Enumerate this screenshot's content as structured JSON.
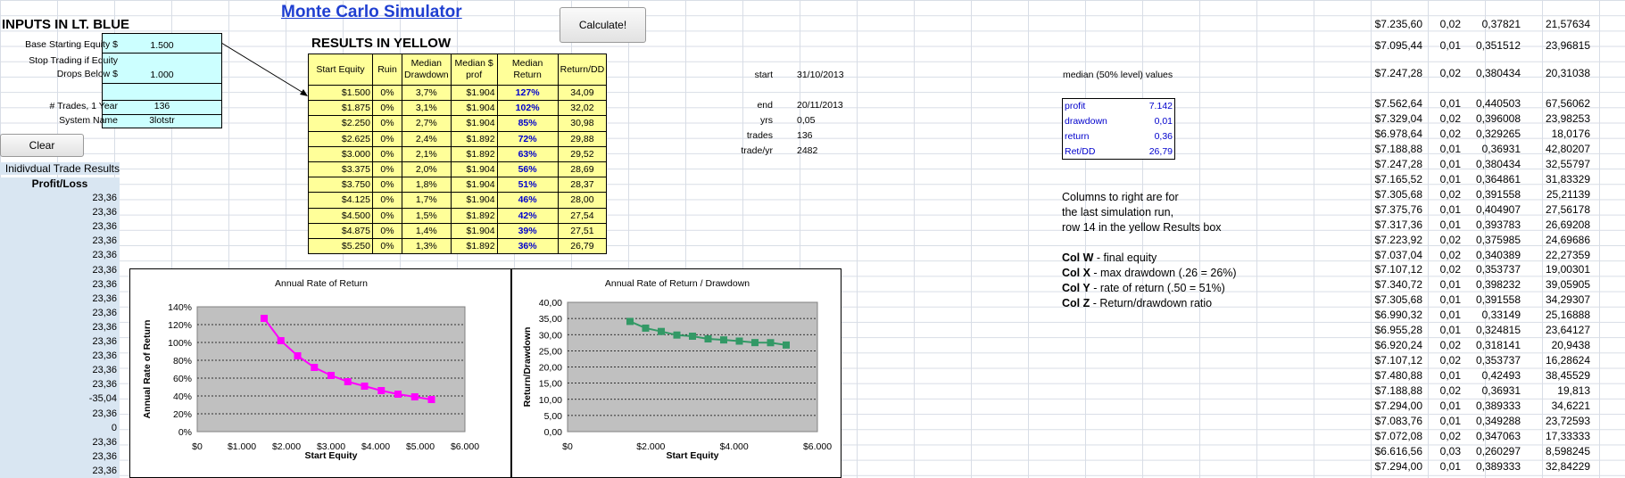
{
  "title": "Monte Carlo Simulator",
  "inputs_header": "INPUTS IN LT. BLUE",
  "results_header": "RESULTS IN YELLOW",
  "calculate_label": "Calculate!",
  "clear_label": "Clear",
  "inputs": [
    {
      "label": "Base Starting Equity $",
      "value": "1.500"
    },
    {
      "label1": "Stop Trading if Equity",
      "label2": "Drops Below $",
      "value": "1.000"
    },
    {
      "label": "# Trades, 1 Year",
      "value": "136"
    },
    {
      "label": "System Name",
      "value": "3lotstr"
    }
  ],
  "trade_results_label": "Inidivdual Trade Results",
  "profit_loss_label": "Profit/Loss",
  "profit_loss_values": [
    "23,36",
    "23,36",
    "23,36",
    "23,36",
    "23,36",
    "23,36",
    "23,36",
    "23,36",
    "23,36",
    "23,36",
    "23,36",
    "23,36",
    "23,36",
    "23,36",
    "-35,04",
    "23,36",
    "0",
    "23,36",
    "23,36",
    "23,36"
  ],
  "results_table": {
    "headers": [
      "Start Equity",
      "Ruin",
      "Median Drawdown",
      "Median $ prof",
      "Median Return",
      "Return/DD"
    ],
    "rows": [
      [
        "$1.500",
        "0%",
        "3,7%",
        "$1.904",
        "127%",
        "34,09"
      ],
      [
        "$1.875",
        "0%",
        "3,1%",
        "$1.904",
        "102%",
        "32,02"
      ],
      [
        "$2.250",
        "0%",
        "2,7%",
        "$1.904",
        "85%",
        "30,98"
      ],
      [
        "$2.625",
        "0%",
        "2,4%",
        "$1.892",
        "72%",
        "29,88"
      ],
      [
        "$3.000",
        "0%",
        "2,1%",
        "$1.892",
        "63%",
        "29,52"
      ],
      [
        "$3.375",
        "0%",
        "2,0%",
        "$1.904",
        "56%",
        "28,69"
      ],
      [
        "$3.750",
        "0%",
        "1,8%",
        "$1.904",
        "51%",
        "28,37"
      ],
      [
        "$4.125",
        "0%",
        "1,7%",
        "$1.904",
        "46%",
        "28,00"
      ],
      [
        "$4.500",
        "0%",
        "1,5%",
        "$1.892",
        "42%",
        "27,54"
      ],
      [
        "$4.875",
        "0%",
        "1,4%",
        "$1.904",
        "39%",
        "27,51"
      ],
      [
        "$5.250",
        "0%",
        "1,3%",
        "$1.892",
        "36%",
        "26,79"
      ]
    ]
  },
  "stats": [
    {
      "label": "start",
      "value": "31/10/2013"
    },
    {
      "label": "end",
      "value": "20/11/2013"
    },
    {
      "label": "yrs",
      "value": "0,05"
    },
    {
      "label": "trades",
      "value": "136"
    },
    {
      "label": "trade/yr",
      "value": "2482"
    }
  ],
  "median_header": "median (50% level) values",
  "median": [
    {
      "label": "profit",
      "value": "7.142"
    },
    {
      "label": "drawdown",
      "value": "0,01"
    },
    {
      "label": "return",
      "value": "0,36"
    },
    {
      "label": "Ret/DD",
      "value": "26,79"
    }
  ],
  "notes": [
    "Columns to right are for",
    "the last simulation run,",
    "row 14 in the yellow Results box"
  ],
  "col_notes": [
    {
      "col": "Col W",
      "text": " - final equity"
    },
    {
      "col": "Col X",
      "text": " - max drawdown (.26 = 26%)"
    },
    {
      "col": "Col Y",
      "text": " - rate of return (.50 = 51%)"
    },
    {
      "col": "Col Z",
      "text": " - Return/drawdown ratio"
    }
  ],
  "right_columns": [
    [
      "$7.235,60",
      "0,02",
      "0,37821",
      "21,57634"
    ],
    [
      "$7.095,44",
      "0,01",
      "0,351512",
      "23,96815"
    ],
    [
      "$7.247,28",
      "0,02",
      "0,380434",
      "20,31038"
    ],
    [
      "$7.562,64",
      "0,01",
      "0,440503",
      "67,56062"
    ],
    [
      "$7.329,04",
      "0,02",
      "0,396008",
      "23,98253"
    ],
    [
      "$6.978,64",
      "0,02",
      "0,329265",
      "18,0176"
    ],
    [
      "$7.188,88",
      "0,01",
      "0,36931",
      "42,80207"
    ],
    [
      "$7.247,28",
      "0,01",
      "0,380434",
      "32,55797"
    ],
    [
      "$7.165,52",
      "0,01",
      "0,364861",
      "31,83329"
    ],
    [
      "$7.305,68",
      "0,02",
      "0,391558",
      "25,21139"
    ],
    [
      "$7.375,76",
      "0,01",
      "0,404907",
      "27,56178"
    ],
    [
      "$7.317,36",
      "0,01",
      "0,393783",
      "26,69208"
    ],
    [
      "$7.223,92",
      "0,02",
      "0,375985",
      "24,69686"
    ],
    [
      "$7.037,04",
      "0,02",
      "0,340389",
      "22,27359"
    ],
    [
      "$7.107,12",
      "0,02",
      "0,353737",
      "19,00301"
    ],
    [
      "$7.340,72",
      "0,01",
      "0,398232",
      "39,05905"
    ],
    [
      "$7.305,68",
      "0,01",
      "0,391558",
      "34,29307"
    ],
    [
      "$6.990,32",
      "0,01",
      "0,33149",
      "25,16888"
    ],
    [
      "$6.955,28",
      "0,01",
      "0,324815",
      "23,64127"
    ],
    [
      "$6.920,24",
      "0,02",
      "0,318141",
      "20,9438"
    ],
    [
      "$7.107,12",
      "0,02",
      "0,353737",
      "16,28624"
    ],
    [
      "$7.480,88",
      "0,01",
      "0,42493",
      "38,45529"
    ],
    [
      "$7.188,88",
      "0,02",
      "0,36931",
      "19,813"
    ],
    [
      "$7.294,00",
      "0,01",
      "0,389333",
      "34,6221"
    ],
    [
      "$7.083,76",
      "0,01",
      "0,349288",
      "23,72593"
    ],
    [
      "$7.072,08",
      "0,02",
      "0,347063",
      "17,33333"
    ],
    [
      "$6.616,56",
      "0,03",
      "0,260297",
      "8,598245"
    ],
    [
      "$7.294,00",
      "0,01",
      "0,389333",
      "32,84229"
    ]
  ],
  "chart_data": [
    {
      "type": "line",
      "title": "Annual Rate of Return",
      "xlabel": "Start Equity",
      "ylabel": "Annual Rate of Return",
      "x": [
        1500,
        1875,
        2250,
        2625,
        3000,
        3375,
        3750,
        4125,
        4500,
        4875,
        5250
      ],
      "y": [
        127,
        102,
        85,
        72,
        63,
        56,
        51,
        46,
        42,
        39,
        36
      ],
      "xlim": [
        0,
        6000
      ],
      "ylim": [
        0,
        140
      ],
      "xticks": [
        "$0",
        "$1.000",
        "$2.000",
        "$3.000",
        "$4.000",
        "$5.000",
        "$6.000"
      ],
      "yticks": [
        "0%",
        "20%",
        "40%",
        "60%",
        "80%",
        "100%",
        "120%",
        "140%"
      ],
      "color": "#ff00ff",
      "grid": true,
      "plot_bg": "#c0c0c0"
    },
    {
      "type": "line",
      "title": "Annual Rate of Return / Drawdown",
      "xlabel": "Start Equity",
      "ylabel": "Return/Drawdown",
      "x": [
        1500,
        1875,
        2250,
        2625,
        3000,
        3375,
        3750,
        4125,
        4500,
        4875,
        5250
      ],
      "y": [
        34.09,
        32.02,
        30.98,
        29.88,
        29.52,
        28.69,
        28.37,
        28.0,
        27.54,
        27.51,
        26.79
      ],
      "xlim": [
        0,
        6000
      ],
      "ylim": [
        0,
        40
      ],
      "xticks": [
        "$0",
        "$2.000",
        "$4.000",
        "$6.000"
      ],
      "yticks": [
        "0,00",
        "5,00",
        "10,00",
        "15,00",
        "20,00",
        "25,00",
        "30,00",
        "35,00",
        "40,00"
      ],
      "color": "#339966",
      "grid": true,
      "plot_bg": "#c0c0c0"
    }
  ]
}
